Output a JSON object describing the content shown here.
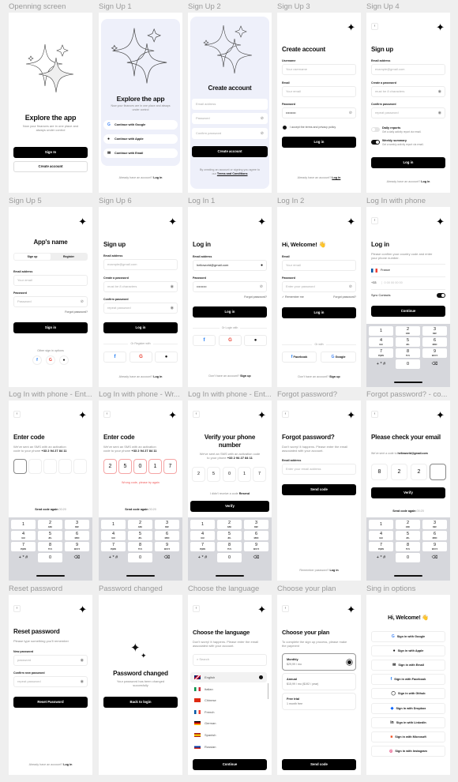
{
  "screens": {
    "opening": {
      "label": "Openning screen",
      "title": "Explore the app",
      "subtitle": "Now your finances are in one place and always under control",
      "primary": "Sign In",
      "secondary": "Create account"
    },
    "signup1": {
      "label": "Sign Up 1",
      "title": "Explore the app",
      "subtitle": "Now your finances are in one place and always under control",
      "options": [
        "Continue with Google",
        "Continue with Apple",
        "Continue with Email"
      ],
      "footer_text": "Already have an account?",
      "footer_link": "Log in"
    },
    "signup2": {
      "label": "Sign Up 2",
      "title": "Create account",
      "email_placeholder": "Email address",
      "password_placeholder": "Password",
      "confirm_placeholder": "Confirm password",
      "button": "Create account",
      "terms_text": "By creating an account or signing you agree to our",
      "terms_link": "Terms and Conditions"
    },
    "signup3": {
      "label": "Sign Up 3",
      "title": "Create account",
      "username_label": "Username",
      "username_placeholder": "Your username",
      "email_label": "Email",
      "email_placeholder": "Your email",
      "password_label": "Password",
      "password_value": "•••••••••",
      "accept_text": "I accept the terms and privacy policy",
      "button": "Log in",
      "footer_text": "Already have an account?",
      "footer_link": "Log in"
    },
    "signup4": {
      "label": "Sign Up 4",
      "title": "Sign up",
      "email_label": "Email address",
      "email_placeholder": "example@gmail.com",
      "create_label": "Create a password",
      "create_placeholder": "must be 8 characters",
      "confirm_label": "Confirm password",
      "confirm_placeholder": "repeat password",
      "toggles": [
        {
          "title": "Daily reports",
          "desc": "Get a daily activity report via email.",
          "on": false
        },
        {
          "title": "Weekly summary",
          "desc": "Get a weekly activity report via email.",
          "on": true
        }
      ],
      "button": "Log in",
      "footer_text": "Already have an account?",
      "footer_link": "Log in"
    },
    "signup5": {
      "label": "Sign Up 5",
      "title": "App's name",
      "tabs": [
        "Sign up",
        "Register"
      ],
      "email_label": "Email address",
      "email_placeholder": "Your email",
      "password_label": "Password",
      "password_placeholder": "Password",
      "forgot": "Forgot password?",
      "button": "Sign in",
      "other": "Other sign in options"
    },
    "signup6": {
      "label": "Sign Up 6",
      "title": "Sign up",
      "email_label": "Email address",
      "email_placeholder": "example@gmail.com",
      "create_label": "Create a password",
      "create_placeholder": "must be 8 characters",
      "confirm_label": "Confirm password",
      "confirm_placeholder": "repeat password",
      "button": "Log in",
      "divider": "Or Register with",
      "footer_text": "Already have an account?",
      "footer_link": "Log in"
    },
    "login1": {
      "label": "Log In 1",
      "title": "Log in",
      "email_label": "Email address",
      "email_value": "helloworld@gmail.com",
      "password_label": "Password",
      "password_value": "•••••••••",
      "forgot": "Forgot password?",
      "button": "Log in",
      "divider": "Or Login with",
      "footer_text": "Don't have an account?",
      "footer_link": "Sign up"
    },
    "login2": {
      "label": "Log In 2",
      "title": "Hi, Welcome! 👋",
      "email_label": "Email",
      "email_placeholder": "Your email",
      "password_label": "Password",
      "password_placeholder": "Enter your password",
      "remember": "Remember me",
      "forgot": "Forgot password?",
      "button": "Log in",
      "divider": "Or with",
      "facebook": "Facebook",
      "google": "Google",
      "footer_text": "Don't have an account?",
      "footer_link": "Sign up"
    },
    "loginphone": {
      "label": "Log In with phone",
      "title": "Log in",
      "subtitle": "Please confirm your country code and enter your phone number.",
      "country": "France",
      "code": "+33",
      "phone_placeholder": "0 00 00 00 00",
      "sync": "Sync Contacts",
      "button": "Continue"
    },
    "entercode": {
      "label": "Log In with phone - Ent...",
      "title": "Enter code",
      "subtitle": "We've sent an SMS with an activation code to your phone",
      "phone": "+33 2 94 27 84 11",
      "resend": "Send code again",
      "timer": "00:20"
    },
    "wrongcode": {
      "label": "Log In with phone - Wr...",
      "title": "Enter code",
      "subtitle": "We've sent an SMS with an activation code to your phone",
      "phone": "+33 2 94 27 84 11",
      "digits": [
        "2",
        "5",
        "0",
        "1",
        "7"
      ],
      "error": "Wrong code, please try again",
      "resend": "Send code again",
      "timer": "00:20"
    },
    "verifyphone": {
      "label": "Log In with phone - Ent...",
      "title": "Verify your phone number",
      "subtitle": "We've sent an SMS with an activation code to your phone",
      "phone": "+33 2 94 27 84 11",
      "digits": [
        "2",
        "5",
        "0",
        "1",
        "7"
      ],
      "noreceive": "I didn't receive a code",
      "resend": "Resend",
      "button": "Verify"
    },
    "forgot": {
      "label": "Forgot password?",
      "title": "Forgot password?",
      "subtitle": "Don't worry! It happens. Please enter the email associated with your account.",
      "email_label": "Email address",
      "email_placeholder": "Enter your email address",
      "button": "Send code",
      "footer_text": "Remember password?",
      "footer_link": "Log in"
    },
    "checkemail": {
      "label": "Forgot password? - co...",
      "title": "Please check your email",
      "subtitle": "We've sent a code to",
      "email": "helloworld@gmail.com",
      "digits": [
        "8",
        "2",
        "2",
        ""
      ],
      "button": "Verify",
      "resend": "Send code again",
      "timer": "00:20"
    },
    "reset": {
      "label": "Reset password",
      "title": "Reset password",
      "subtitle": "Please type something you'll remember",
      "new_label": "New password",
      "new_placeholder": "password",
      "confirm_label": "Confirm new password",
      "confirm_placeholder": "repeat password",
      "button": "Reset Password",
      "footer_text": "Already have an account?",
      "footer_link": "Log in"
    },
    "changed": {
      "label": "Password changed",
      "title": "Password changed",
      "subtitle": "Your password has been changed succesfully",
      "button": "Back to login"
    },
    "language": {
      "label": "Choose the language",
      "title": "Choose the language",
      "subtitle": "Don't worry! It happens. Please enter the email associated with your account.",
      "search_placeholder": "Search",
      "languages": [
        "English",
        "Italian",
        "Chinese",
        "French",
        "German",
        "Spanish",
        "Russian"
      ],
      "selected": "English",
      "button": "Continue"
    },
    "plan": {
      "label": "Choose your plan",
      "title": "Choose your plan",
      "subtitle": "To complete the sign up process, please make the payment",
      "plans": [
        {
          "name": "Monthly",
          "price": "$29,99 / mo"
        },
        {
          "name": "Annual",
          "price": "$15,99 / mo ($192 / year)"
        },
        {
          "name": "Free trial",
          "price": "1 month free"
        }
      ],
      "selected": "Monthly",
      "button": "Send code"
    },
    "signinoptions": {
      "label": "Sing in options",
      "title": "Hi, Welcome! 👋",
      "options": [
        "Sign in with Google",
        "Sign in with Apple",
        "Sign in with Email",
        "Sign in with Facebook",
        "Sign in with Github",
        "Sign in with Dropbox",
        "Sign in with LinkedIn",
        "Sign in with Microsoft",
        "Sign in with Instagram"
      ]
    }
  },
  "keypad": {
    "keys": [
      {
        "d": "1",
        "l": ""
      },
      {
        "d": "2",
        "l": "ABC"
      },
      {
        "d": "3",
        "l": "DEF"
      },
      {
        "d": "4",
        "l": "GHI"
      },
      {
        "d": "5",
        "l": "JKL"
      },
      {
        "d": "6",
        "l": "MNO"
      },
      {
        "d": "7",
        "l": "PQRS"
      },
      {
        "d": "8",
        "l": "TUV"
      },
      {
        "d": "9",
        "l": "WXYZ"
      },
      {
        "d": "+ * #",
        "l": ""
      },
      {
        "d": "0",
        "l": ""
      },
      {
        "d": "⌫",
        "l": ""
      }
    ]
  },
  "colors": {
    "accent": "#000000",
    "panel_bg": "#eef0fa",
    "error": "#f05a5a",
    "canvas": "#efefef"
  }
}
